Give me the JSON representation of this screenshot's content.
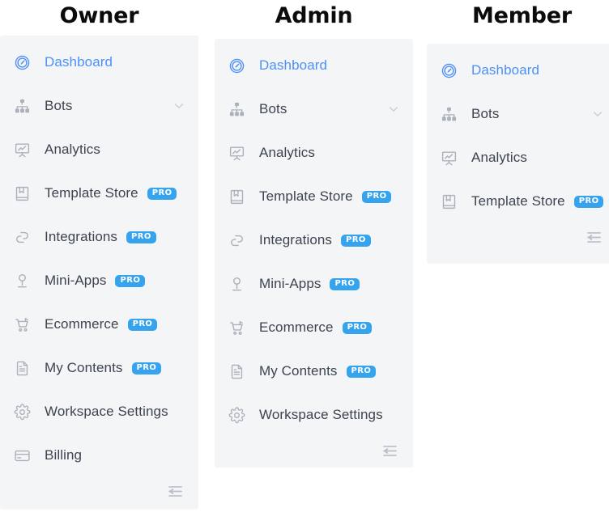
{
  "accent_colors": {
    "active_blue": "#4d90f7",
    "pro_badge_blue": "#36a3ee",
    "icon_gray": "#aab1bb",
    "label_gray": "#3c4450",
    "panel_bg": "#f4f5f7",
    "page_bg": "#ffffff"
  },
  "columns": [
    {
      "title": "Owner",
      "collapse_label": "",
      "items": [
        {
          "label": "Dashboard",
          "icon": "dashboard-gauge-icon",
          "active": true,
          "pro": "",
          "chevron": false
        },
        {
          "label": "Bots",
          "icon": "sitemap-icon",
          "active": false,
          "pro": "",
          "chevron": true
        },
        {
          "label": "Analytics",
          "icon": "presentation-chart-icon",
          "active": false,
          "pro": "",
          "chevron": false
        },
        {
          "label": "Template Store",
          "icon": "bookmark-book-icon",
          "active": false,
          "pro": "PRO",
          "chevron": false
        },
        {
          "label": "Integrations",
          "icon": "linked-chain-icon",
          "active": false,
          "pro": "PRO",
          "chevron": false
        },
        {
          "label": "Mini-Apps",
          "icon": "joystick-pin-icon",
          "active": false,
          "pro": "PRO",
          "chevron": false
        },
        {
          "label": "Ecommerce",
          "icon": "shopping-cart-icon",
          "active": false,
          "pro": "PRO",
          "chevron": false
        },
        {
          "label": "My Contents",
          "icon": "document-icon",
          "active": false,
          "pro": "PRO",
          "chevron": false
        },
        {
          "label": "Workspace Settings",
          "icon": "gear-icon",
          "active": false,
          "pro": "",
          "chevron": false
        },
        {
          "label": "Billing",
          "icon": "credit-card-icon",
          "active": false,
          "pro": "",
          "chevron": false
        }
      ]
    },
    {
      "title": "Admin",
      "collapse_label": "",
      "items": [
        {
          "label": "Dashboard",
          "icon": "dashboard-gauge-icon",
          "active": true,
          "pro": "",
          "chevron": false
        },
        {
          "label": "Bots",
          "icon": "sitemap-icon",
          "active": false,
          "pro": "",
          "chevron": true
        },
        {
          "label": "Analytics",
          "icon": "presentation-chart-icon",
          "active": false,
          "pro": "",
          "chevron": false
        },
        {
          "label": "Template Store",
          "icon": "bookmark-book-icon",
          "active": false,
          "pro": "PRO",
          "chevron": false
        },
        {
          "label": "Integrations",
          "icon": "linked-chain-icon",
          "active": false,
          "pro": "PRO",
          "chevron": false
        },
        {
          "label": "Mini-Apps",
          "icon": "joystick-pin-icon",
          "active": false,
          "pro": "PRO",
          "chevron": false
        },
        {
          "label": "Ecommerce",
          "icon": "shopping-cart-icon",
          "active": false,
          "pro": "PRO",
          "chevron": false
        },
        {
          "label": "My Contents",
          "icon": "document-icon",
          "active": false,
          "pro": "PRO",
          "chevron": false
        },
        {
          "label": "Workspace Settings",
          "icon": "gear-icon",
          "active": false,
          "pro": "",
          "chevron": false
        }
      ]
    },
    {
      "title": "Member",
      "collapse_label": "",
      "items": [
        {
          "label": "Dashboard",
          "icon": "dashboard-gauge-icon",
          "active": true,
          "pro": "",
          "chevron": false
        },
        {
          "label": "Bots",
          "icon": "sitemap-icon",
          "active": false,
          "pro": "",
          "chevron": true
        },
        {
          "label": "Analytics",
          "icon": "presentation-chart-icon",
          "active": false,
          "pro": "",
          "chevron": false
        },
        {
          "label": "Template Store",
          "icon": "bookmark-book-icon",
          "active": false,
          "pro": "PRO",
          "chevron": false
        }
      ]
    }
  ]
}
